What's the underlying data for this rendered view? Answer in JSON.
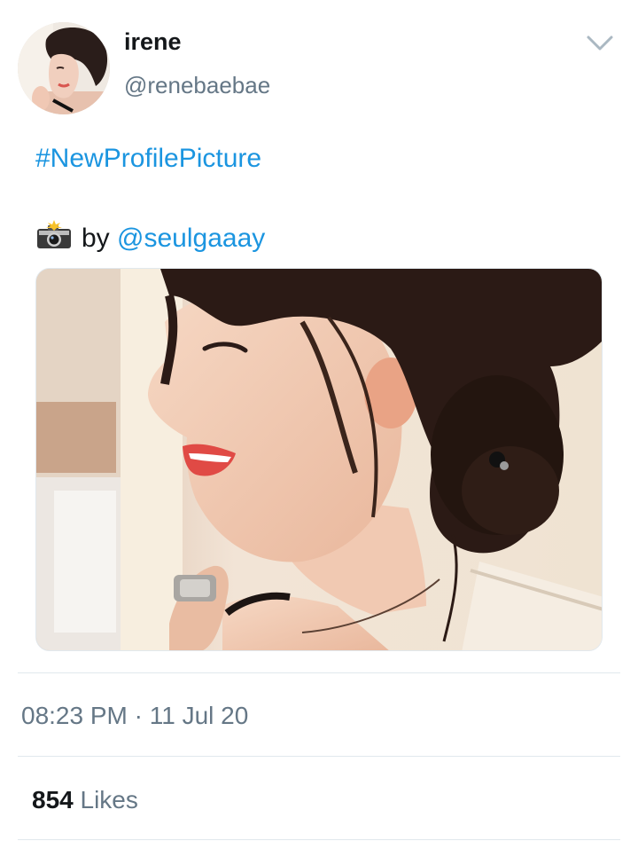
{
  "author": {
    "display_name": "irene",
    "handle": "@renebaebae"
  },
  "tweet": {
    "hashtag": "#NewProfilePicture",
    "credit_prefix": "by",
    "credit_mention": "@seulgaaay",
    "camera_icon": "camera-with-flash-icon",
    "caret_icon": "chevron-down-icon"
  },
  "meta": {
    "time": "08:23 PM",
    "separator": "·",
    "date": "11 Jul 20"
  },
  "stats": {
    "likes_count": "854",
    "likes_label": "Likes"
  },
  "colors": {
    "link": "#1b95e0",
    "secondary_text": "#657786",
    "primary_text": "#14171a",
    "divider": "#e1e8ed"
  }
}
